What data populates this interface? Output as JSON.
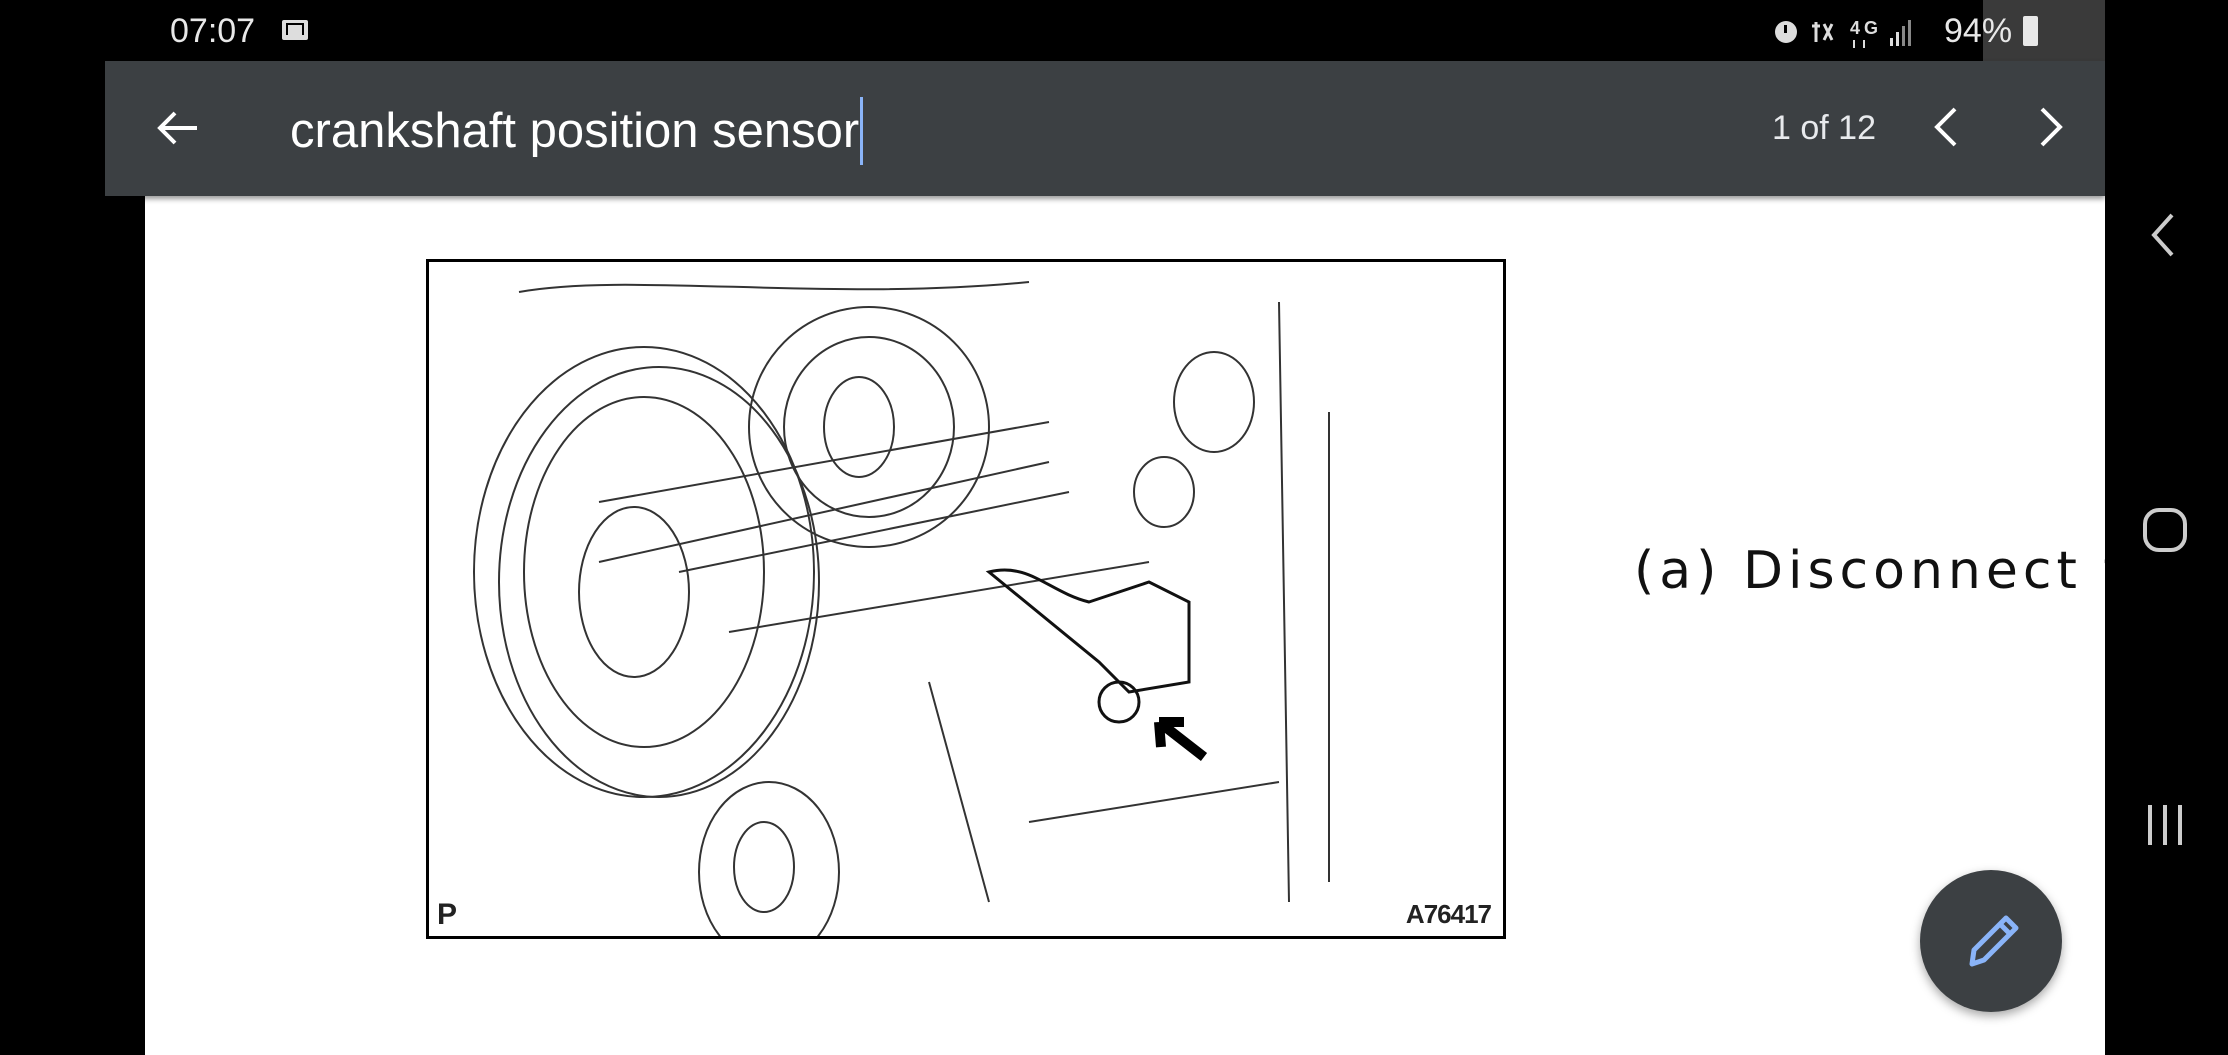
{
  "status_bar": {
    "time": "07:07",
    "battery": "94%",
    "icons": [
      "mail-icon",
      "alarm-icon",
      "mute-icon",
      "4g-icon",
      "signal-icon",
      "battery-icon"
    ]
  },
  "find_bar": {
    "query": "crankshaft position sensor",
    "match_count": "1 of 12",
    "icons": [
      "back-arrow-icon",
      "chevron-left-icon",
      "chevron-right-icon"
    ]
  },
  "document": {
    "figure": {
      "corner_label": "P",
      "figure_id": "A76417"
    },
    "step_text": "(a) Disconnect t"
  },
  "fab": {
    "icon": "pencil-icon",
    "color": "#8ab4f8"
  },
  "colors": {
    "toolbar": "#3c4043",
    "caret": "#8ab4f8"
  }
}
